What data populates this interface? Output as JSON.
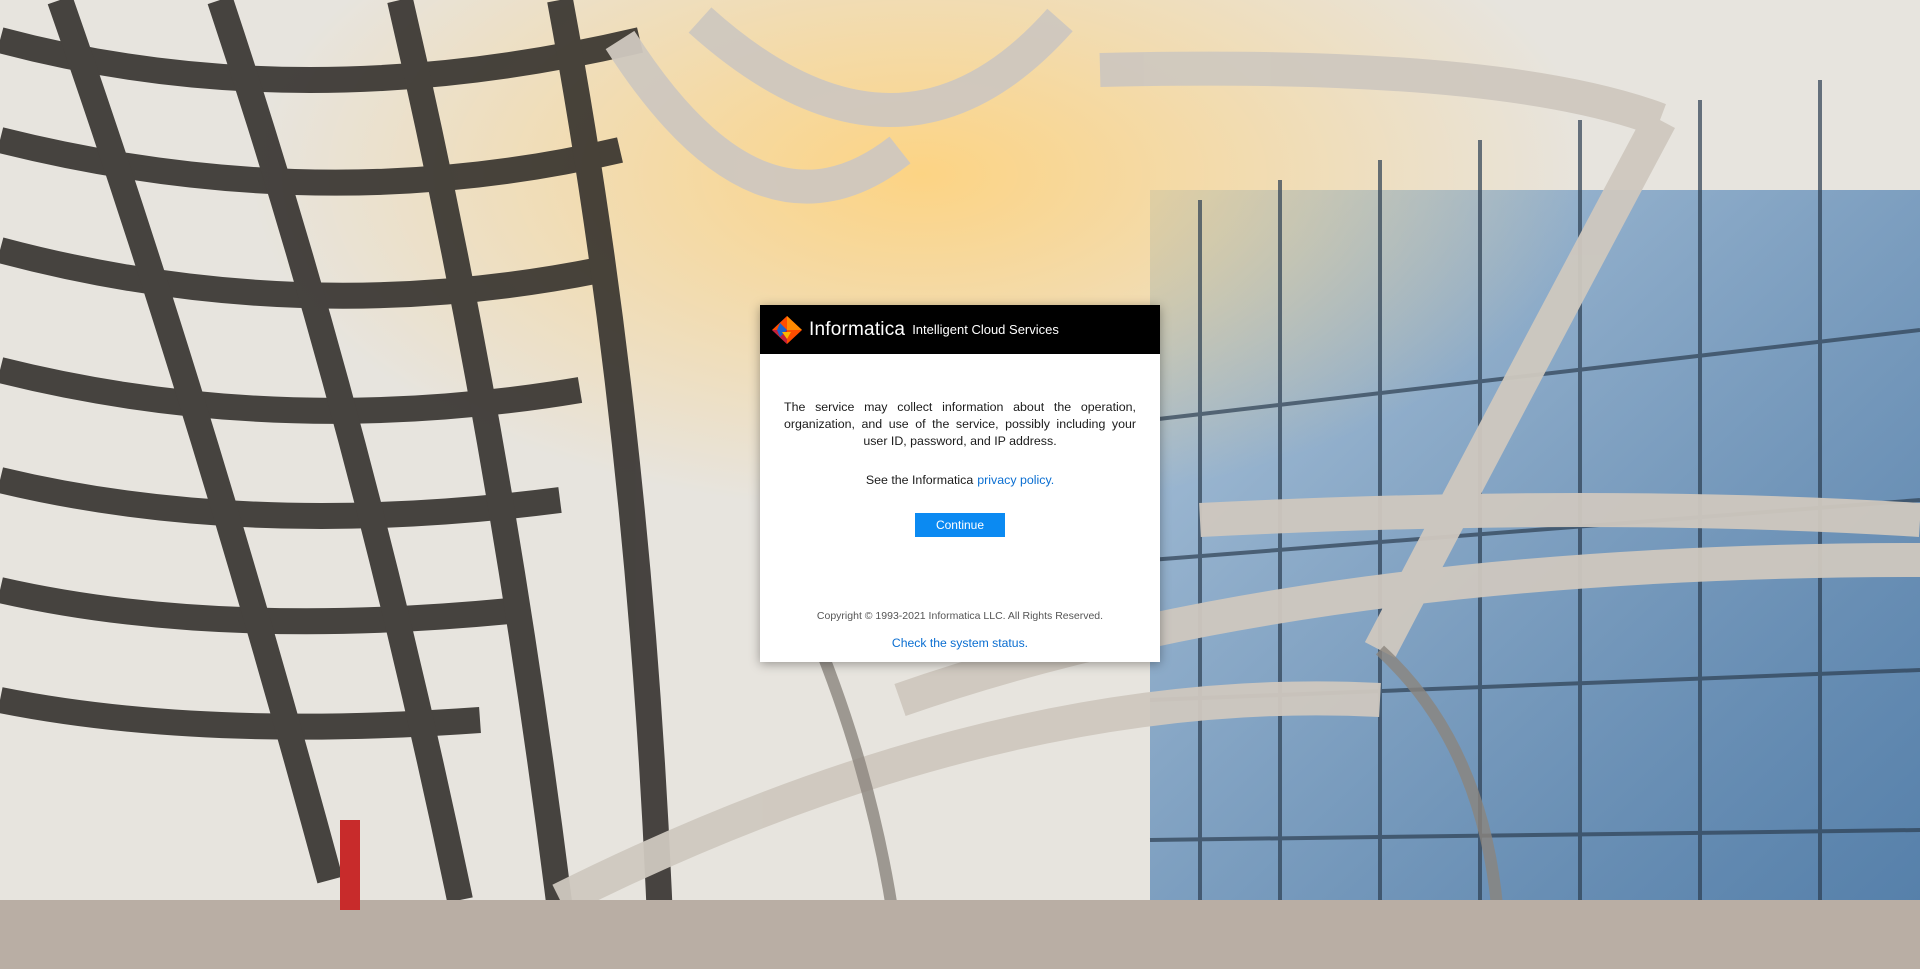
{
  "header": {
    "brand": "Informatica",
    "product": "Intelligent Cloud Services",
    "logo_icon": "informatica-diamond-icon"
  },
  "notice": {
    "text": "The service may collect information about the operation, organization, and use of the service, possibly including your user ID, password, and IP address."
  },
  "policy": {
    "prefix": "See the Informatica",
    "link_label": "privacy policy."
  },
  "actions": {
    "continue_label": "Continue"
  },
  "footer": {
    "copyright": "Copyright © 1993-2021 Informatica LLC. All Rights Reserved.",
    "status_link": "Check the system status."
  },
  "colors": {
    "header_bg": "#000000",
    "link": "#0a6ed1",
    "button": "#0b8af2"
  }
}
